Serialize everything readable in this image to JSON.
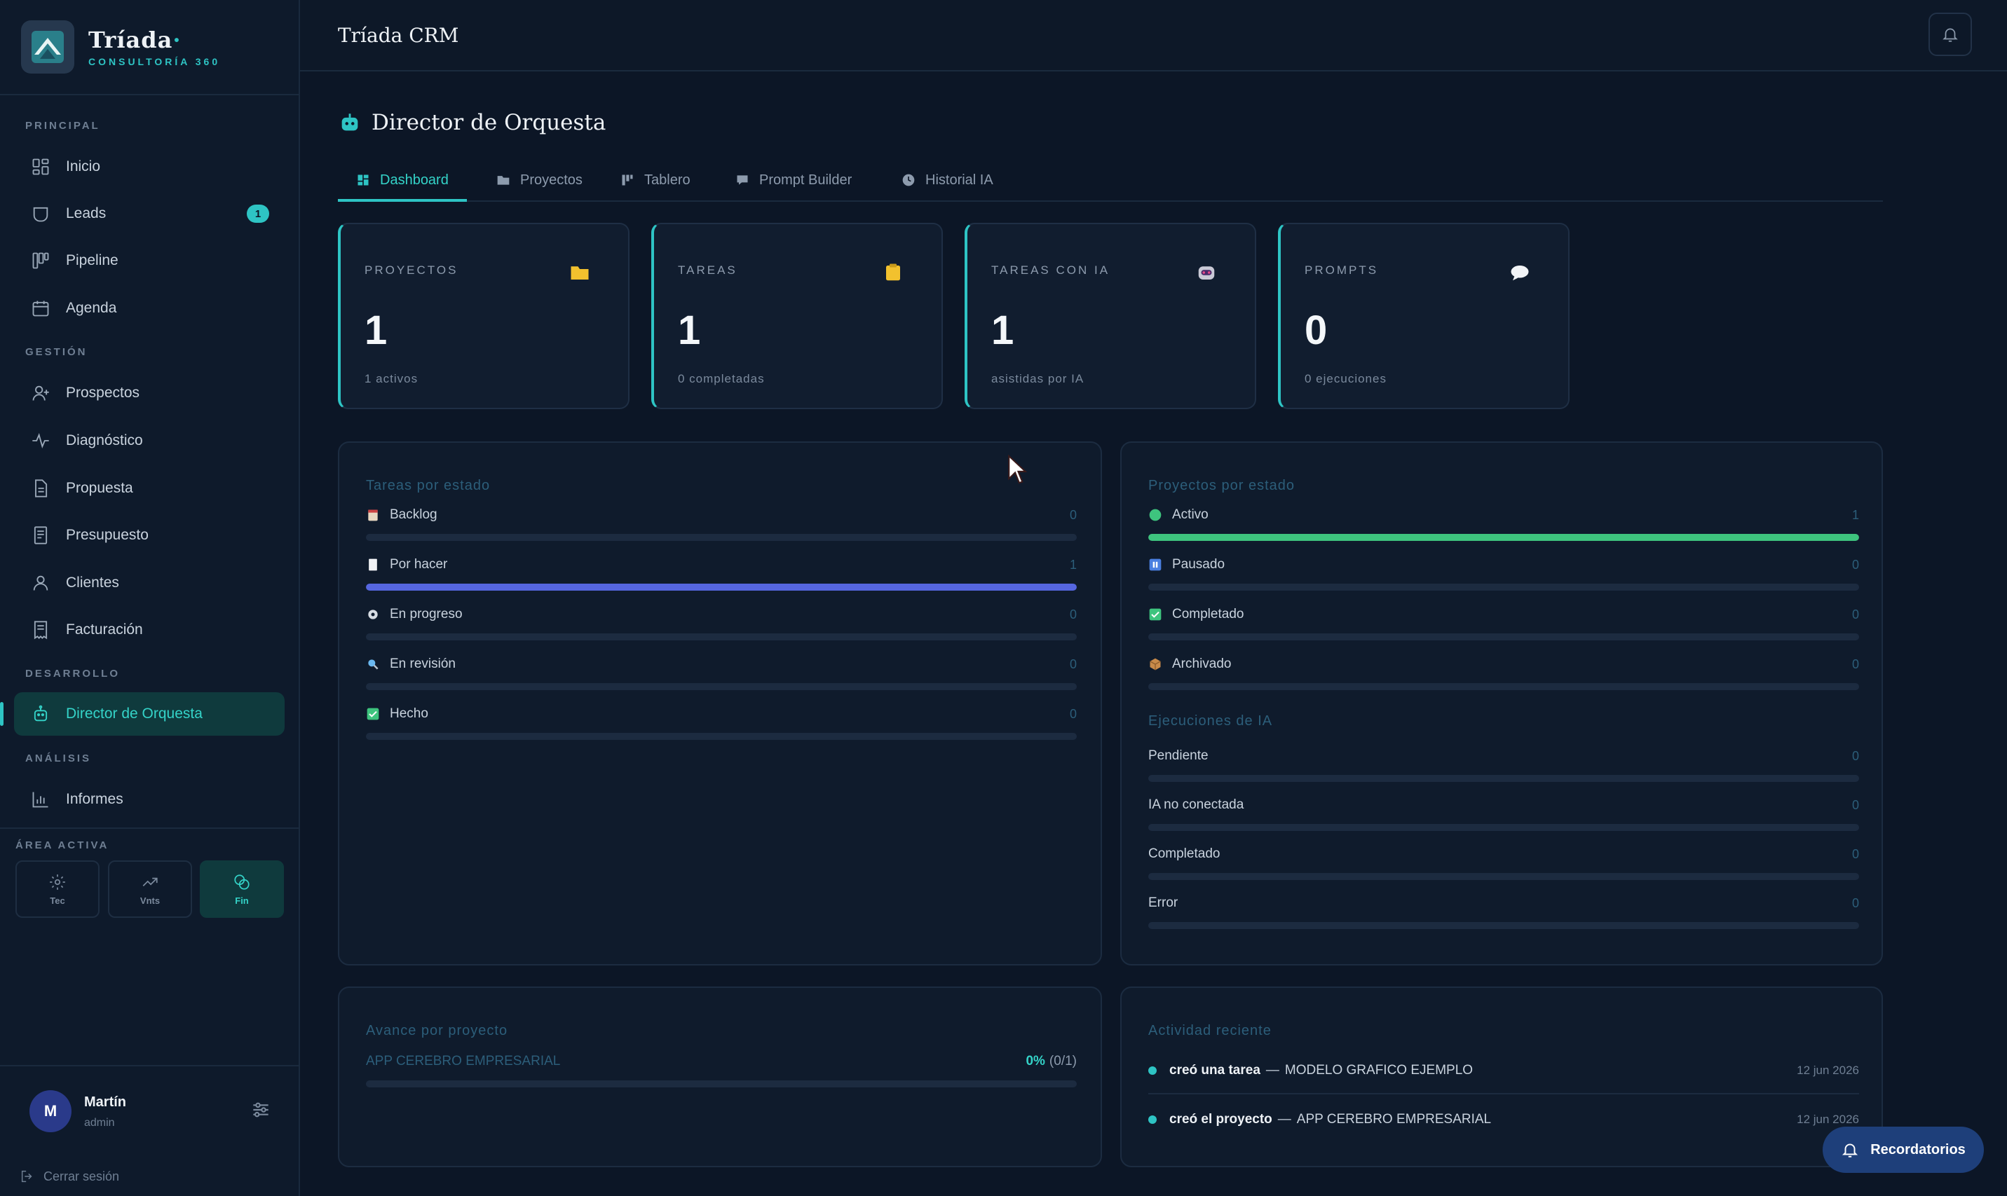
{
  "brand": {
    "name": "Tríada",
    "dot": "·",
    "subtitle": "CONSULTORÍA 360"
  },
  "sidebar": {
    "sections": {
      "principal": "PRINCIPAL",
      "gestion": "GESTIÓN",
      "desarrollo": "DESARROLLO",
      "analisis": "ANÁLISIS"
    },
    "items": [
      {
        "label": "Inicio",
        "icon": "grid-icon"
      },
      {
        "label": "Leads",
        "icon": "inbox-icon",
        "badge": "1"
      },
      {
        "label": "Pipeline",
        "icon": "kanban-icon"
      },
      {
        "label": "Agenda",
        "icon": "calendar-icon"
      },
      {
        "label": "Prospectos",
        "icon": "user-plus-icon"
      },
      {
        "label": "Diagnóstico",
        "icon": "pulse-icon"
      },
      {
        "label": "Propuesta",
        "icon": "document-icon"
      },
      {
        "label": "Presupuesto",
        "icon": "receipt-icon"
      },
      {
        "label": "Clientes",
        "icon": "user-icon"
      },
      {
        "label": "Facturación",
        "icon": "invoice-icon"
      },
      {
        "label": "Director  de  Orquesta",
        "icon": "robot-icon",
        "active": true
      },
      {
        "label": "Informes",
        "icon": "bar-chart-icon"
      }
    ],
    "area": {
      "label": "ÁREA ACTIVA",
      "options": [
        {
          "label": "Tec",
          "icon": "gear-icon"
        },
        {
          "label": "Vnts",
          "icon": "trend-icon"
        },
        {
          "label": "Fin",
          "icon": "coins-icon",
          "active": true
        }
      ]
    },
    "user": {
      "initial": "M",
      "name": "Martín",
      "role": "admin"
    },
    "logout": "Cerrar  sesión"
  },
  "topbar": {
    "title": "Tríada CRM"
  },
  "page": {
    "title": "Director de Orquesta",
    "tabs": [
      {
        "label": "Dashboard",
        "icon": "dashboard-icon",
        "active": true
      },
      {
        "label": "Proyectos",
        "icon": "folder-icon"
      },
      {
        "label": "Tablero",
        "icon": "board-icon"
      },
      {
        "label": "Prompt  Builder",
        "icon": "chat-icon"
      },
      {
        "label": "Historial  IA",
        "icon": "clock-icon"
      }
    ]
  },
  "stats": [
    {
      "label": "PROYECTOS",
      "value": "1",
      "sub": "1  activos",
      "icon": "folder-icon"
    },
    {
      "label": "TAREAS",
      "value": "1",
      "sub": "0  completadas",
      "icon": "clipboard-icon"
    },
    {
      "label": "TAREAS  CON  IA",
      "value": "1",
      "sub": "asistidas  por  IA",
      "icon": "robot-icon"
    },
    {
      "label": "PROMPTS",
      "value": "0",
      "sub": "0  ejecuciones",
      "icon": "speech-bubble-icon"
    }
  ],
  "tareas_estado": {
    "title": "Tareas  por  estado",
    "rows": [
      {
        "label": "Backlog",
        "count": "0",
        "fraction": 0
      },
      {
        "label": "Por  hacer",
        "count": "1",
        "fraction": 1
      },
      {
        "label": "En  progreso",
        "count": "0",
        "fraction": 0
      },
      {
        "label": "En  revisión",
        "count": "0",
        "fraction": 0
      },
      {
        "label": "Hecho",
        "count": "0",
        "fraction": 0
      }
    ]
  },
  "proyectos_estado": {
    "title": "Proyectos  por  estado",
    "rows": [
      {
        "label": "Activo",
        "count": "1",
        "fraction": 1
      },
      {
        "label": "Pausado",
        "count": "0",
        "fraction": 0
      },
      {
        "label": "Completado",
        "count": "0",
        "fraction": 0
      },
      {
        "label": "Archivado",
        "count": "0",
        "fraction": 0
      }
    ]
  },
  "ejecuciones": {
    "title": "Ejecuciones  de  IA",
    "rows": [
      {
        "label": "Pendiente",
        "count": "0",
        "fraction": 0
      },
      {
        "label": "IA  no  conectada",
        "count": "0",
        "fraction": 0
      },
      {
        "label": "Completado",
        "count": "0",
        "fraction": 0
      },
      {
        "label": "Error",
        "count": "0",
        "fraction": 0
      }
    ]
  },
  "avance": {
    "title": "Avance  por  proyecto",
    "project": "APP  CEREBRO  EMPRESARIAL",
    "percent": "0%",
    "ratio": "(0/1)",
    "fraction": 0
  },
  "actividad": {
    "title": "Actividad  reciente",
    "items": [
      {
        "verb": "creó  una  tarea",
        "sep": "—",
        "object": "MODELO  GRAFICO  EJEMPLO",
        "date": "12 jun 2026"
      },
      {
        "verb": "creó  el  proyecto",
        "sep": "—",
        "object": "APP  CEREBRO  EMPRESARIAL",
        "date": "12 jun 2026"
      }
    ]
  },
  "recordatorios": {
    "label": "Recordatorios"
  },
  "colors": {
    "accent": "#2ec4c4",
    "tareas_bar": "#5566e0",
    "proyectos_bar": "#3ec47e"
  }
}
